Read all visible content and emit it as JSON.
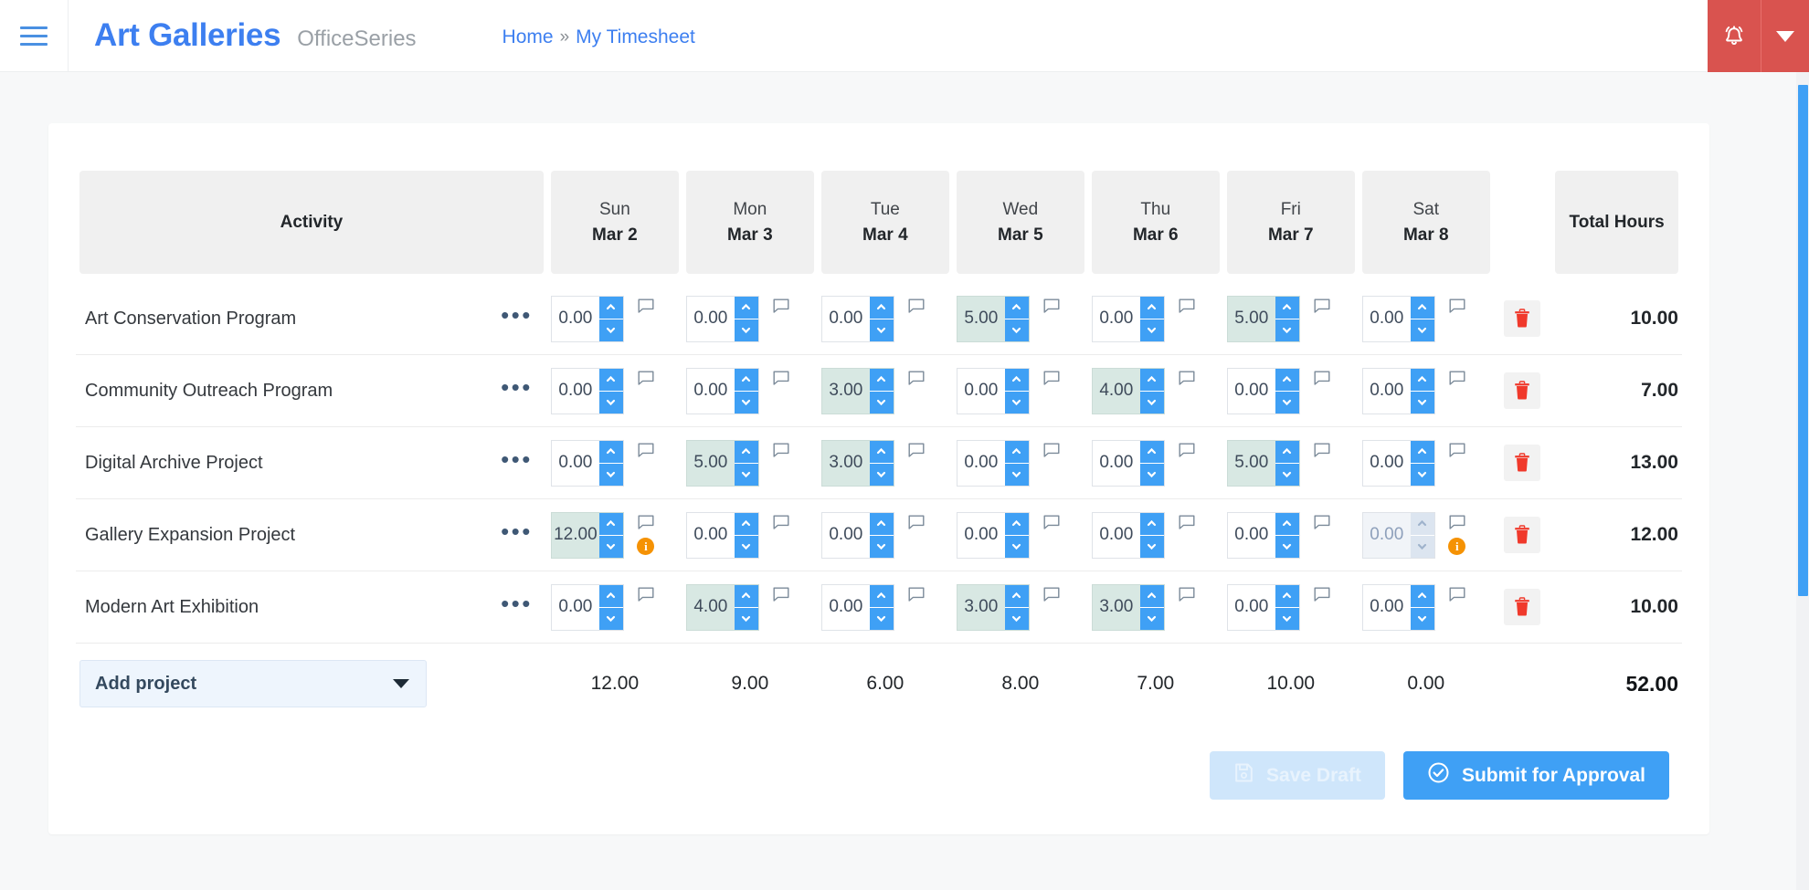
{
  "topbar": {
    "menu_icon": "hamburger-icon",
    "brand_title": "Art Galleries",
    "brand_subtitle": "OfficeSeries",
    "breadcrumb": {
      "home": "Home",
      "separator": "»",
      "current": "My Timesheet"
    },
    "notification_icon": "alarm-bell-icon",
    "notification_caret_icon": "chevron-down-icon",
    "notification_color": "#d9534f"
  },
  "table": {
    "headers": {
      "activity": "Activity",
      "total": "Total Hours",
      "days": [
        {
          "day": "Sun",
          "date": "Mar 2"
        },
        {
          "day": "Mon",
          "date": "Mar 3"
        },
        {
          "day": "Tue",
          "date": "Mar 4"
        },
        {
          "day": "Wed",
          "date": "Mar 5"
        },
        {
          "day": "Thu",
          "date": "Mar 6"
        },
        {
          "day": "Fri",
          "date": "Mar 7"
        },
        {
          "day": "Sat",
          "date": "Mar 8"
        }
      ]
    },
    "rows": [
      {
        "activity": "Art Conservation Program",
        "menu_icon": "ellipsis-icon",
        "delete_icon": "trash-icon",
        "total": "10.00",
        "cells": [
          {
            "value": "0.00",
            "filled": false,
            "disabled": false,
            "info": false
          },
          {
            "value": "0.00",
            "filled": false,
            "disabled": false,
            "info": false
          },
          {
            "value": "0.00",
            "filled": false,
            "disabled": false,
            "info": false
          },
          {
            "value": "5.00",
            "filled": true,
            "disabled": false,
            "info": false
          },
          {
            "value": "0.00",
            "filled": false,
            "disabled": false,
            "info": false
          },
          {
            "value": "5.00",
            "filled": true,
            "disabled": false,
            "info": false
          },
          {
            "value": "0.00",
            "filled": false,
            "disabled": false,
            "info": false
          }
        ]
      },
      {
        "activity": "Community Outreach Program",
        "menu_icon": "ellipsis-icon",
        "delete_icon": "trash-icon",
        "total": "7.00",
        "cells": [
          {
            "value": "0.00",
            "filled": false,
            "disabled": false,
            "info": false
          },
          {
            "value": "0.00",
            "filled": false,
            "disabled": false,
            "info": false
          },
          {
            "value": "3.00",
            "filled": true,
            "disabled": false,
            "info": false
          },
          {
            "value": "0.00",
            "filled": false,
            "disabled": false,
            "info": false
          },
          {
            "value": "4.00",
            "filled": true,
            "disabled": false,
            "info": false
          },
          {
            "value": "0.00",
            "filled": false,
            "disabled": false,
            "info": false
          },
          {
            "value": "0.00",
            "filled": false,
            "disabled": false,
            "info": false
          }
        ]
      },
      {
        "activity": "Digital Archive Project",
        "menu_icon": "ellipsis-icon",
        "delete_icon": "trash-icon",
        "total": "13.00",
        "cells": [
          {
            "value": "0.00",
            "filled": false,
            "disabled": false,
            "info": false
          },
          {
            "value": "5.00",
            "filled": true,
            "disabled": false,
            "info": false
          },
          {
            "value": "3.00",
            "filled": true,
            "disabled": false,
            "info": false
          },
          {
            "value": "0.00",
            "filled": false,
            "disabled": false,
            "info": false
          },
          {
            "value": "0.00",
            "filled": false,
            "disabled": false,
            "info": false
          },
          {
            "value": "5.00",
            "filled": true,
            "disabled": false,
            "info": false
          },
          {
            "value": "0.00",
            "filled": false,
            "disabled": false,
            "info": false
          }
        ]
      },
      {
        "activity": "Gallery Expansion Project",
        "menu_icon": "ellipsis-icon",
        "delete_icon": "trash-icon",
        "total": "12.00",
        "cells": [
          {
            "value": "12.00",
            "filled": true,
            "disabled": false,
            "info": true
          },
          {
            "value": "0.00",
            "filled": false,
            "disabled": false,
            "info": false
          },
          {
            "value": "0.00",
            "filled": false,
            "disabled": false,
            "info": false
          },
          {
            "value": "0.00",
            "filled": false,
            "disabled": false,
            "info": false
          },
          {
            "value": "0.00",
            "filled": false,
            "disabled": false,
            "info": false
          },
          {
            "value": "0.00",
            "filled": false,
            "disabled": false,
            "info": false
          },
          {
            "value": "0.00",
            "filled": false,
            "disabled": true,
            "info": true
          }
        ]
      },
      {
        "activity": "Modern Art Exhibition",
        "menu_icon": "ellipsis-icon",
        "delete_icon": "trash-icon",
        "total": "10.00",
        "cells": [
          {
            "value": "0.00",
            "filled": false,
            "disabled": false,
            "info": false
          },
          {
            "value": "4.00",
            "filled": true,
            "disabled": false,
            "info": false
          },
          {
            "value": "0.00",
            "filled": false,
            "disabled": false,
            "info": false
          },
          {
            "value": "3.00",
            "filled": true,
            "disabled": false,
            "info": false
          },
          {
            "value": "3.00",
            "filled": true,
            "disabled": false,
            "info": false
          },
          {
            "value": "0.00",
            "filled": false,
            "disabled": false,
            "info": false
          },
          {
            "value": "0.00",
            "filled": false,
            "disabled": false,
            "info": false
          }
        ]
      }
    ],
    "footer": {
      "add_project_label": "Add project",
      "add_project_caret_icon": "caret-down-icon",
      "day_totals": [
        "12.00",
        "9.00",
        "6.00",
        "8.00",
        "7.00",
        "10.00",
        "0.00"
      ],
      "grand_total": "52.00"
    }
  },
  "actions": {
    "save_draft_label": "Save Draft",
    "save_draft_icon": "floppy-disk-icon",
    "save_draft_disabled": true,
    "submit_label": "Submit for Approval",
    "submit_icon": "check-circle-icon",
    "submit_color": "#3fa0f5"
  },
  "note_icon": "comment-icon",
  "info_icon": "info-badge-icon",
  "scrollbar": {
    "thumb_color": "#3fa0f5"
  }
}
